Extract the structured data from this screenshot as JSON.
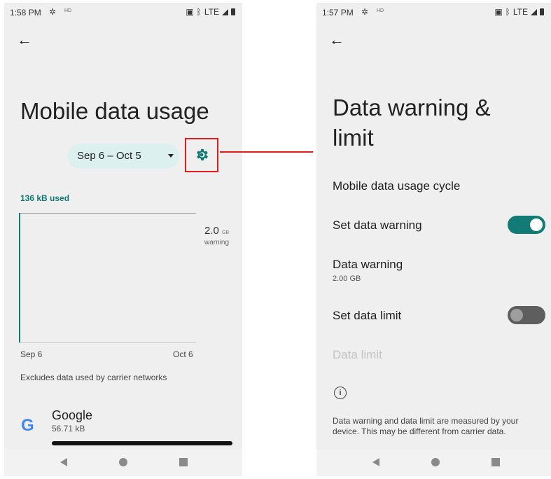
{
  "left": {
    "status": {
      "time": "1:58 PM",
      "hd": "HD",
      "network": "LTE"
    },
    "title": "Mobile data usage",
    "date_range": "Sep 6 – Oct 5",
    "used": "136 kB used",
    "chart": {
      "warning_value": "2.0",
      "warning_unit": "GB",
      "warning_label": "warning",
      "x_start": "Sep 6",
      "x_end": "Oct 6"
    },
    "excludes_note": "Excludes data used by carrier networks",
    "app": {
      "icon": "G",
      "name": "Google",
      "usage": "56.71 kB"
    }
  },
  "right": {
    "status": {
      "time": "1:57 PM",
      "hd": "HD",
      "network": "LTE"
    },
    "title_line1": "Data warning &",
    "title_line2": "limit",
    "items": [
      {
        "label": "Mobile data usage cycle"
      },
      {
        "label": "Set data warning",
        "toggle": true
      },
      {
        "label": "Data warning",
        "sub": "2.00 GB"
      },
      {
        "label": "Set data limit",
        "toggle": false
      },
      {
        "label": "Data limit",
        "disabled": true
      }
    ],
    "footnote": "Data warning and data limit are measured by your device. This may be different from carrier data."
  },
  "colors": {
    "accent": "#137b75",
    "highlight": "#e31d1d",
    "pill": "#dcf0f0"
  },
  "icons": [
    "settings-gear-icon",
    "back-arrow-icon",
    "info-icon",
    "google-logo"
  ]
}
